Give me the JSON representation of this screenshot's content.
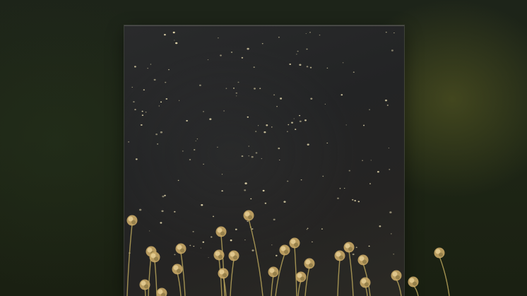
{
  "scene": {
    "subjects": [
      "dark-speckled-panel",
      "dried-flower-heads"
    ],
    "colors": {
      "background": "#1e2616",
      "panel": "#252526",
      "glow": "#6e6e28",
      "speck": "#e8dcb0",
      "flower": "#c9a866",
      "stem": "#b8a55a"
    }
  }
}
